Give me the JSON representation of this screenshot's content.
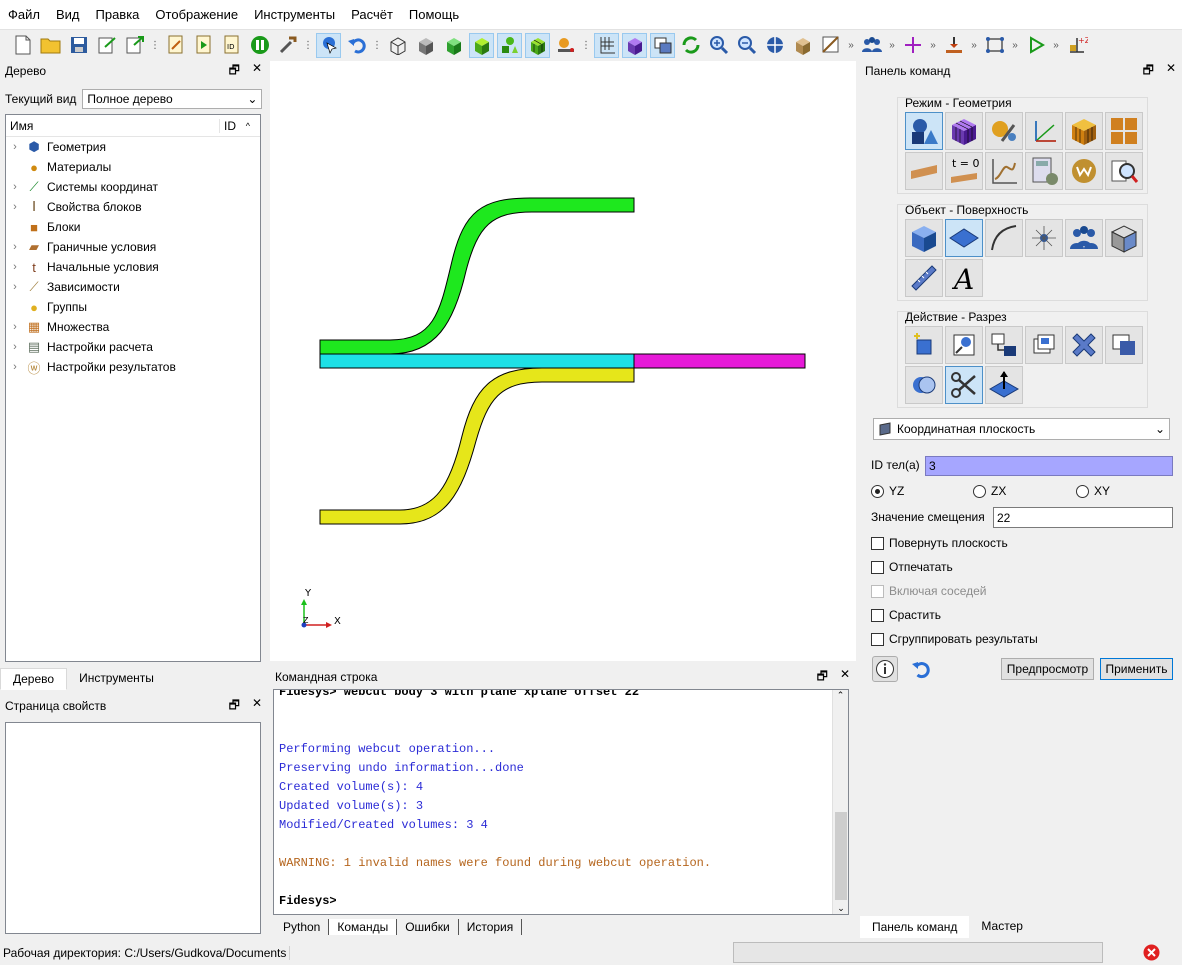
{
  "menu": [
    "Файл",
    "Вид",
    "Правка",
    "Отображение",
    "Инструменты",
    "Расчёт",
    "Помощь"
  ],
  "toolbar": {
    "icons": [
      "new-file-icon",
      "open-folder-icon",
      "save-icon",
      "export-icon",
      "import-icon",
      "edit-journal-icon",
      "play-journal-icon",
      "id-icon",
      "pause-icon",
      "tools-icon",
      "select-icon",
      "undo-icon",
      "wireframe-box-icon",
      "solid-box-icon",
      "green-box-icon",
      "green-cube-icon",
      "green-shapes-icon",
      "mesh-cube-icon",
      "physics-icon",
      "grid-axes-icon",
      "purple-cube-icon",
      "overlay-icon",
      "refresh-icon",
      "zoom-in-icon",
      "zoom-out-icon",
      "fit-view-icon",
      "box-icon",
      "ruler-icon"
    ],
    "right_icons": [
      "blue-people-icon",
      "plus-cross-icon",
      "download-icon",
      "rect-points-icon",
      "run-icon",
      "z-axis-icon"
    ]
  },
  "tree": {
    "title": "Дерево",
    "view_label": "Текущий вид",
    "view_value": "Полное дерево",
    "col_name": "Имя",
    "col_id": "ID",
    "items": [
      {
        "label": "Геометрия",
        "icon": "geometry-icon",
        "color": "#2a5aa8"
      },
      {
        "label": "Материалы",
        "icon": "materials-icon",
        "color": "#d08a10"
      },
      {
        "label": "Системы координат",
        "icon": "coords-icon",
        "color": "#1c8a2e"
      },
      {
        "label": "Свойства блоков",
        "icon": "block-props-icon",
        "color": "#6a4a20"
      },
      {
        "label": "Блоки",
        "icon": "blocks-icon",
        "color": "#c0701a"
      },
      {
        "label": "Граничные условия",
        "icon": "bc-icon",
        "color": "#b07030"
      },
      {
        "label": "Начальные условия",
        "icon": "ic-icon",
        "color": "#804020"
      },
      {
        "label": "Зависимости",
        "icon": "dependencies-icon",
        "color": "#a08040"
      },
      {
        "label": "Группы",
        "icon": "groups-icon",
        "color": "#e0b020"
      },
      {
        "label": "Множества",
        "icon": "sets-icon",
        "color": "#c07020"
      },
      {
        "label": "Настройки расчета",
        "icon": "calc-settings-icon",
        "color": "#607060"
      },
      {
        "label": "Настройки результатов",
        "icon": "results-settings-icon",
        "color": "#b08030"
      }
    ],
    "tabs": [
      "Дерево",
      "Инструменты"
    ]
  },
  "properties": {
    "title": "Страница свойств"
  },
  "command": {
    "title": "Командная строка",
    "lines": [
      {
        "text": "Fidesys> webcut body 3 with plane xplane offset 22",
        "color": "#000000",
        "bold": true
      },
      {
        "text": "",
        "color": "#000000",
        "bold": false
      },
      {
        "text": "",
        "color": "#000000",
        "bold": false
      },
      {
        "text": "Performing webcut operation...",
        "color": "#2b2bd6",
        "bold": false
      },
      {
        "text": "Preserving undo information...done",
        "color": "#2b2bd6",
        "bold": false
      },
      {
        "text": "Created volume(s): 4",
        "color": "#2b2bd6",
        "bold": false
      },
      {
        "text": "Updated volume(s): 3",
        "color": "#2b2bd6",
        "bold": false
      },
      {
        "text": "Modified/Created volumes: 3 4",
        "color": "#2b2bd6",
        "bold": false
      },
      {
        "text": "",
        "color": "#000000",
        "bold": false
      },
      {
        "text": "WARNING: 1 invalid names were found during webcut operation.",
        "color": "#b5651d",
        "bold": false
      },
      {
        "text": "",
        "color": "#000000",
        "bold": false
      },
      {
        "text": "Fidesys>",
        "color": "#000000",
        "bold": true
      }
    ],
    "tabs": [
      "Python",
      "Команды",
      "Ошибки",
      "История"
    ]
  },
  "viewport": {
    "axis_y": "Y",
    "axis_x": "X",
    "axis_z": "Z",
    "body_colors": {
      "green": "#1ee81e",
      "cyan": "#1ee0e6",
      "magenta": "#e61ad8",
      "yellow": "#e6e61a"
    }
  },
  "right_panel": {
    "title": "Панель команд",
    "mode_title": "Режим - Геометрия",
    "object_title": "Объект - Поверхность",
    "action_title": "Действие - Разрез",
    "mode_icons": [
      "geometry-mode-icon",
      "mesh-mode-icon",
      "materials-mode-icon",
      "coords-mode-icon",
      "blocks-mode-icon",
      "sets-mode-icon",
      "bc-mode-icon",
      "ic-mode-icon",
      "dependencies-mode-icon",
      "calc-mode-icon",
      "results-mode-icon",
      "analysis-mode-icon"
    ],
    "ic_label": "t = 0",
    "object_icons": [
      "volume-icon",
      "surface-icon",
      "curve-icon",
      "vertex-icon",
      "group-icon",
      "body-icon",
      "ruler-obj-icon",
      "text-obj-icon"
    ],
    "action_icons": [
      "create-icon",
      "modify-icon",
      "transform-icon",
      "copy-icon",
      "delete-icon",
      "imprint-icon",
      "boolean-icon",
      "webcut-icon",
      "plane-cut-icon"
    ],
    "method_select": "Координатная плоскость",
    "body_id_label": "ID тел(а)",
    "body_id_value": "3",
    "radio_yz": "YZ",
    "radio_zx": "ZX",
    "radio_xy": "XY",
    "offset_label": "Значение смещения",
    "offset_value": "22",
    "chk_rotate": "Повернуть плоскость",
    "chk_imprint": "Отпечатать",
    "chk_neighbors": "Включая соседей",
    "chk_merge": "Срастить",
    "chk_group": "Сгруппировать результаты",
    "preview": "Предпросмотр",
    "apply": "Применить",
    "tabs": [
      "Панель команд",
      "Мастер"
    ]
  },
  "status": {
    "working_dir": "Рабочая директория: C:/Users/Gudkova/Documents"
  }
}
